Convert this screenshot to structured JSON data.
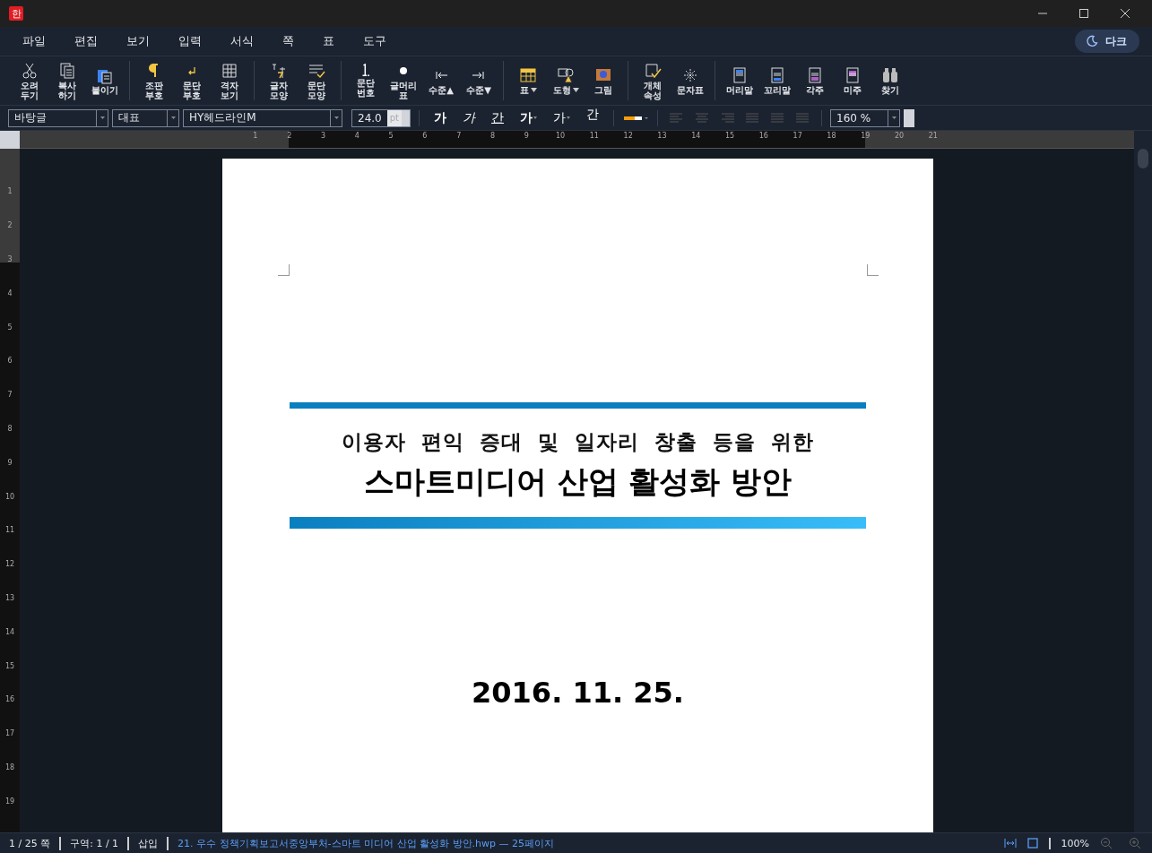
{
  "app_logo": "한",
  "menu": [
    "파일",
    "편집",
    "보기",
    "입력",
    "서식",
    "쪽",
    "표",
    "도구"
  ],
  "theme_toggle": {
    "label": "다크"
  },
  "toolbar": [
    [
      {
        "kind": "scissors",
        "lines": [
          "오려",
          "두기"
        ]
      },
      {
        "kind": "copy",
        "lines": [
          "복사",
          "하기"
        ]
      },
      {
        "kind": "paste",
        "lines": [
          "붙이기"
        ]
      }
    ],
    [
      {
        "kind": "pilcrow",
        "lines": [
          "조판",
          "부호"
        ]
      },
      {
        "kind": "return",
        "lines": [
          "문단",
          "부호"
        ]
      },
      {
        "kind": "grid",
        "lines": [
          "격자",
          "보기"
        ]
      }
    ],
    [
      {
        "kind": "charshape",
        "lines": [
          "글자",
          "모양"
        ]
      },
      {
        "kind": "parashape",
        "lines": [
          "문단",
          "모양"
        ]
      }
    ],
    [
      {
        "kind": "numbering",
        "lines": [
          "문단",
          "번호"
        ]
      },
      {
        "kind": "bullet",
        "lines": [
          "글머리",
          "표"
        ]
      },
      {
        "kind": "outdent",
        "lines": [
          "수준▲"
        ]
      },
      {
        "kind": "indent",
        "lines": [
          "수준▼"
        ]
      }
    ],
    [
      {
        "kind": "table",
        "lines": [
          "표"
        ],
        "dropdown": true
      },
      {
        "kind": "shapes",
        "lines": [
          "도형"
        ],
        "dropdown": true
      },
      {
        "kind": "picture",
        "lines": [
          "그림"
        ]
      }
    ],
    [
      {
        "kind": "objprops",
        "lines": [
          "개체",
          "속성"
        ]
      },
      {
        "kind": "symbol",
        "lines": [
          "문자표"
        ]
      }
    ],
    [
      {
        "kind": "header",
        "lines": [
          "머리말"
        ]
      },
      {
        "kind": "footer",
        "lines": [
          "꼬리말"
        ]
      },
      {
        "kind": "footnote",
        "lines": [
          "각주"
        ]
      },
      {
        "kind": "endnote",
        "lines": [
          "미주"
        ]
      },
      {
        "kind": "binoculars",
        "lines": [
          "찾기"
        ]
      }
    ]
  ],
  "format_bar": {
    "style": "바탕글",
    "language": "대표",
    "font": "HY헤드라인M",
    "size": "24.0",
    "unit": "pt",
    "char_buttons": [
      {
        "kind": "bold",
        "label": "가"
      },
      {
        "kind": "italic",
        "label": "가"
      },
      {
        "kind": "underline",
        "label": "간"
      },
      {
        "kind": "strike",
        "label": "가",
        "dropdown": true
      },
      {
        "kind": "color",
        "label": "가",
        "dropdown": true
      },
      {
        "kind": "highlight",
        "label": "간"
      }
    ],
    "zoom": "160 %"
  },
  "ruler": {
    "horizontal": [
      "1",
      "2",
      "3",
      "4",
      "5",
      "6",
      "7",
      "8",
      "9",
      "10",
      "11",
      "12",
      "13",
      "14",
      "15",
      "16",
      "17",
      "18",
      "19",
      "20",
      "21"
    ],
    "vertical": [
      "1",
      "2",
      "3",
      "4",
      "5",
      "6",
      "7",
      "8",
      "9",
      "10",
      "11",
      "12",
      "13",
      "14",
      "15",
      "16",
      "17",
      "18",
      "19"
    ]
  },
  "document": {
    "subtitle": "이용자 편익 증대 및 일자리 창출 등을 위한",
    "title": "스마트미디어 산업 활성화 방안",
    "date": "2016. 11. 25."
  },
  "status_bar": {
    "page": "1 / 25 쪽",
    "section": "구역: 1 / 1",
    "mode": "삽입",
    "file": "21. 우수 정책기획보고서중앙부처-스마트 미디어 산업 활성화 방안.hwp — 25페이지",
    "zoom": "100%"
  }
}
